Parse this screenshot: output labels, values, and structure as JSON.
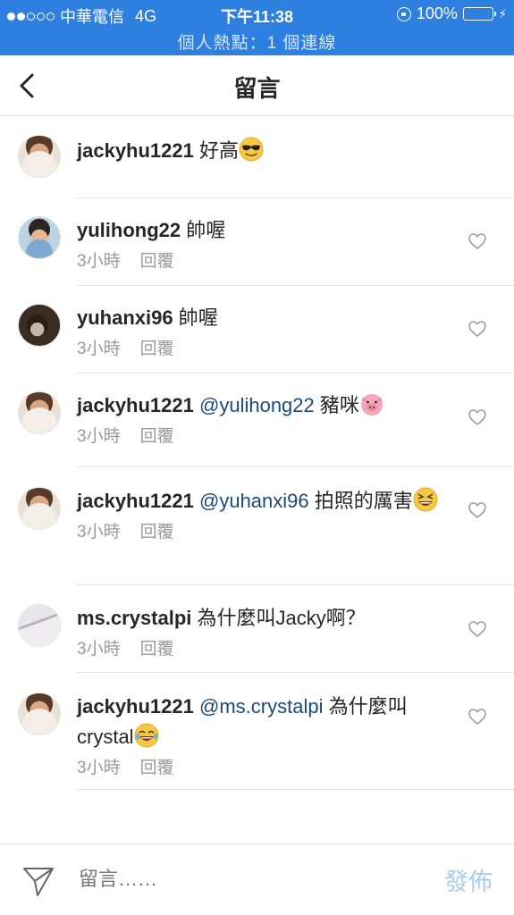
{
  "status_bar": {
    "carrier": "中華電信",
    "network": "4G",
    "time": "下午11:38",
    "battery": "100%",
    "signal_bars_filled": 2,
    "signal_bars_total": 5,
    "hotspot": "個人熱點：1 個連線"
  },
  "nav": {
    "title": "留言",
    "back_icon": "chevron-left-icon"
  },
  "comments": [
    {
      "username": "jackyhu1221",
      "mention": "",
      "text": "好高",
      "emoji": "sunglasses",
      "time": "",
      "reply": "",
      "has_heart": false
    },
    {
      "username": "yulihong22",
      "mention": "",
      "text": "帥喔",
      "emoji": "",
      "time": "3小時",
      "reply": "回覆",
      "has_heart": true
    },
    {
      "username": "yuhanxi96",
      "mention": "",
      "text": "帥喔",
      "emoji": "",
      "time": "3小時",
      "reply": "回覆",
      "has_heart": true
    },
    {
      "username": "jackyhu1221",
      "mention": "@yulihong22",
      "text": "豬咪",
      "emoji": "pig",
      "time": "3小時",
      "reply": "回覆",
      "has_heart": true
    },
    {
      "username": "jackyhu1221",
      "mention": "@yuhanxi96",
      "text": "拍照的厲害",
      "emoji": "laughing",
      "time": "3小時",
      "reply": "回覆",
      "has_heart": true
    },
    {
      "username": "ms.crystalpi",
      "mention": "",
      "text": "為什麼叫Jacky啊？",
      "emoji": "",
      "time": "3小時",
      "reply": "回覆",
      "has_heart": true
    },
    {
      "username": "jackyhu1221",
      "mention": "@ms.crystalpi",
      "text": "為什麼叫crystal",
      "emoji": "tears-of-joy",
      "time": "3小時",
      "reply": "回覆",
      "has_heart": true
    }
  ],
  "footer": {
    "placeholder": "留言……",
    "post_label": "發佈"
  },
  "colors": {
    "status_bar_bg": "#2d7fe0",
    "mention": "#1b4a7a",
    "post_button": "#a7cdf3",
    "meta_text": "#999999"
  }
}
